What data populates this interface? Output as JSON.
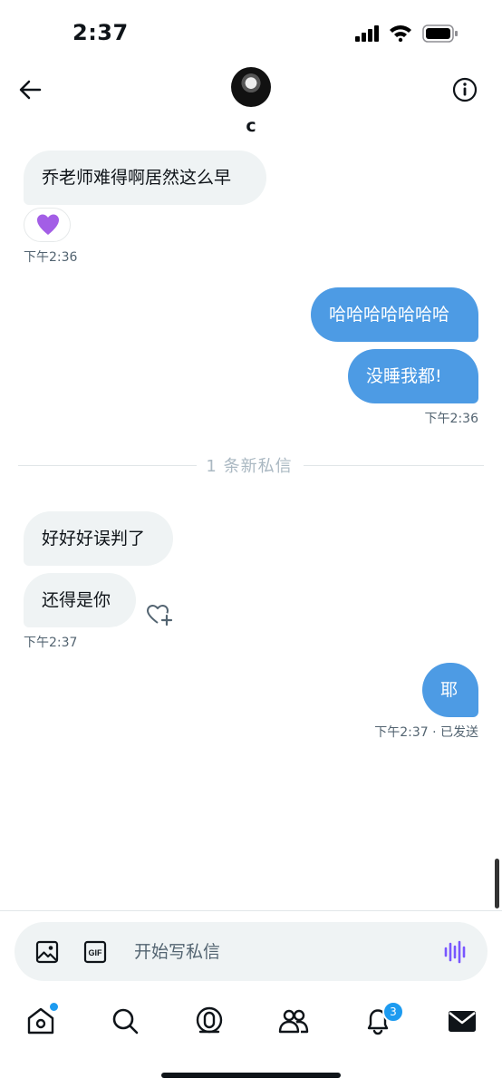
{
  "status": {
    "time": "2:37"
  },
  "header": {
    "title": "c"
  },
  "messages": [
    {
      "text": "乔老师难得啊居然这么早",
      "direction": "in",
      "reaction": "💜"
    },
    {
      "text": "哈哈哈哈哈哈哈",
      "direction": "out"
    },
    {
      "text": "没睡我都!",
      "direction": "out"
    },
    {
      "text": "好好好误判了",
      "direction": "in"
    },
    {
      "text": "还得是你",
      "direction": "in"
    },
    {
      "text": "耶",
      "direction": "out"
    }
  ],
  "timestamps": {
    "t1": "下午2:36",
    "t2": "下午2:36",
    "t3": "下午2:37",
    "t4": "下午2:37 · 已发送"
  },
  "divider": {
    "label": "1 条新私信"
  },
  "composer": {
    "placeholder": "开始写私信"
  },
  "nav": {
    "items": [
      "home-icon",
      "search-icon",
      "spaces-icon",
      "communities-icon",
      "notifications-icon",
      "messages-icon"
    ],
    "notification_count": "3"
  },
  "colors": {
    "outgoing_bubble": "#4d9be4",
    "incoming_bubble": "#eff3f4",
    "accent": "#1d9bf0",
    "voice": "#7856ff"
  }
}
